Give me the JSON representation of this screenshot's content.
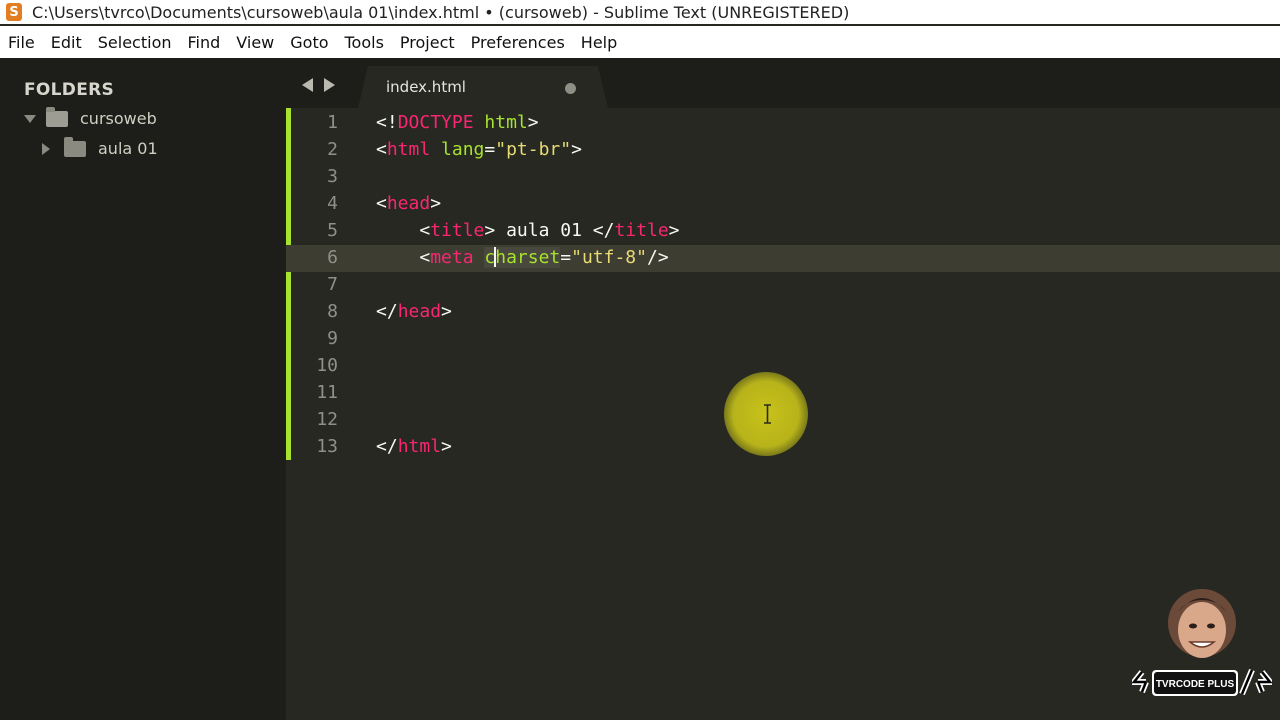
{
  "window": {
    "title": "C:\\Users\\tvrco\\Documents\\cursoweb\\aula 01\\index.html • (cursoweb) - Sublime Text (UNREGISTERED)",
    "app_icon": "sublime-text-icon"
  },
  "menu": [
    "File",
    "Edit",
    "Selection",
    "Find",
    "View",
    "Goto",
    "Tools",
    "Project",
    "Preferences",
    "Help"
  ],
  "sidebar": {
    "title": "FOLDERS",
    "folders": [
      {
        "label": "cursoweb",
        "expanded": true
      },
      {
        "label": "aula 01",
        "expanded": false
      }
    ]
  },
  "tabs": [
    {
      "label": "index.html",
      "dirty": true
    }
  ],
  "editor": {
    "current_line": 6,
    "line_numbers": [
      "1",
      "2",
      "3",
      "4",
      "5",
      "6",
      "7",
      "8",
      "9",
      "10",
      "11",
      "12",
      "13"
    ],
    "lines": [
      "<!DOCTYPE html>",
      "<html lang=\"pt-br\">",
      "",
      "<head>",
      "    <title> aula 01 </title>",
      "    <meta charset=\"utf-8\"/>",
      "",
      "</head>",
      "",
      "",
      "",
      "",
      "</html>"
    ]
  },
  "watermark": {
    "text": "TVRCODE PLUS"
  },
  "colors": {
    "background": "#272822",
    "sidebar": "#1d1e19",
    "tag": "#f92672",
    "attribute": "#a6e22e",
    "string": "#e6db74",
    "git_gutter": "#a6e22e"
  }
}
